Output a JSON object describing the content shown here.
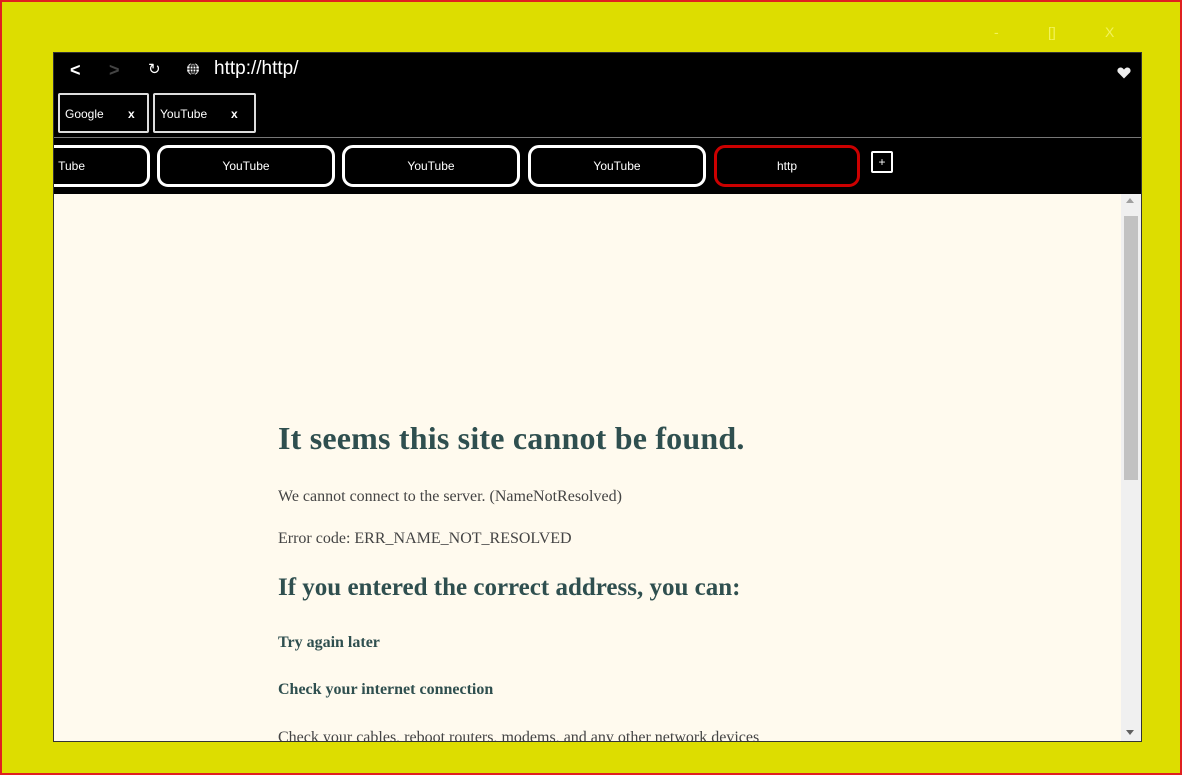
{
  "window": {
    "minimize_label": "-",
    "maximize_label": "[]",
    "close_label": "X"
  },
  "toolbar": {
    "back_label": "<",
    "forward_label": ">",
    "refresh_label": "↻",
    "address": "http://http/",
    "favorite_icon": "heart-icon",
    "globe_icon": "globe-icon"
  },
  "small_tabs": [
    {
      "label": "Google",
      "close": "x"
    },
    {
      "label": "YouTube",
      "close": "x"
    }
  ],
  "tabs": [
    {
      "label": "Tube"
    },
    {
      "label": "YouTube"
    },
    {
      "label": "YouTube"
    },
    {
      "label": "YouTube"
    },
    {
      "label": "http",
      "active": true
    }
  ],
  "new_tab_label": "+",
  "error_page": {
    "title": "It seems this site cannot be found.",
    "message": "We cannot connect to the server. (NameNotResolved)",
    "code": "Error code: ERR_NAME_NOT_RESOLVED",
    "subtitle": "If you entered the correct address, you can:",
    "suggestion_1": "Try again later",
    "suggestion_2": "Check your internet connection",
    "suggestion_3": "Check your cables, reboot routers, modems, and any other network devices"
  },
  "colors": {
    "frame_background": "#dddd00",
    "frame_border": "#e02020",
    "active_tab_border": "#cc0000",
    "content_background": "#fffaee",
    "heading_color": "#2f4f4f"
  }
}
